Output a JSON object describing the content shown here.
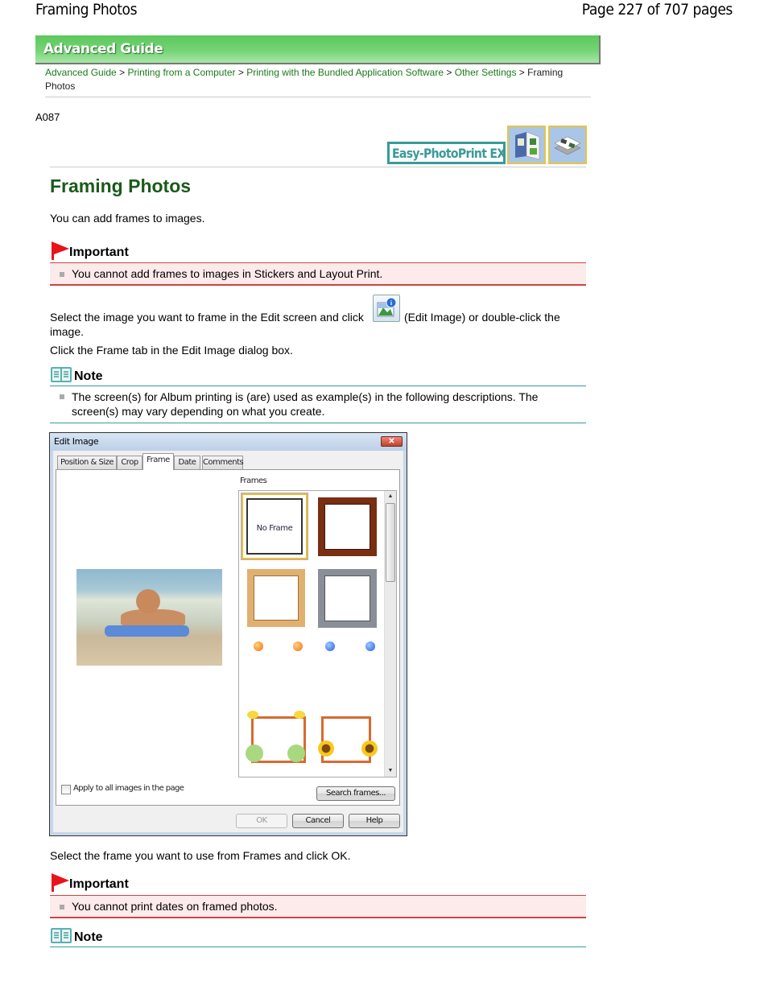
{
  "header": {
    "title": "Framing Photos",
    "page_info": "Page 227 of 707 pages"
  },
  "banner": {
    "label": "Advanced Guide"
  },
  "breadcrumb": {
    "items": [
      "Advanced Guide",
      "Printing from a Computer",
      "Printing with the Bundled Application Software",
      "Other Settings"
    ],
    "separator": ">",
    "current": "Framing Photos"
  },
  "doc_code": "A087",
  "app_logo": {
    "label": "Easy-PhotoPrint EX"
  },
  "page": {
    "title": "Framing Photos",
    "intro": "You can add frames to images.",
    "important1": {
      "heading": "Important",
      "items": [
        "You cannot add frames to images in Stickers and Layout Print."
      ]
    },
    "step1_part1": "Select the image you want to frame in the Edit screen and click",
    "step1_part2": "(Edit Image) or double-click the",
    "step1_part3": "image.",
    "step2": "Click the Frame tab in the Edit Image dialog box.",
    "note1": {
      "heading": "Note",
      "items": [
        "The screen(s) for Album printing is (are) used as example(s) in the following descriptions. The screen(s) may vary depending on what you create."
      ]
    },
    "step3": "Select the frame you want to use from Frames and click OK.",
    "important2": {
      "heading": "Important",
      "items": [
        "You cannot print dates on framed photos."
      ]
    },
    "note2": {
      "heading": "Note"
    }
  },
  "dialog": {
    "title": "Edit Image",
    "close": "✕",
    "tabs": [
      "Position & Size",
      "Crop",
      "Frame",
      "Date",
      "Comments"
    ],
    "active_tab": "Frame",
    "frames_label": "Frames",
    "no_frame_label": "No Frame",
    "apply_all_label": "Apply to all images in the page",
    "apply_all_checked": false,
    "search_button": "Search frames...",
    "ok_button": "OK",
    "cancel_button": "Cancel",
    "help_button": "Help",
    "scroll_up": "▲",
    "scroll_down": "▼"
  },
  "colors": {
    "banner_green": "#5cc85c",
    "title_green": "#1a5a1a",
    "link_green": "#1a7a1a",
    "important_red": "#cc4444",
    "important_bg": "#fdeaea",
    "note_teal": "#3a9a9a"
  }
}
